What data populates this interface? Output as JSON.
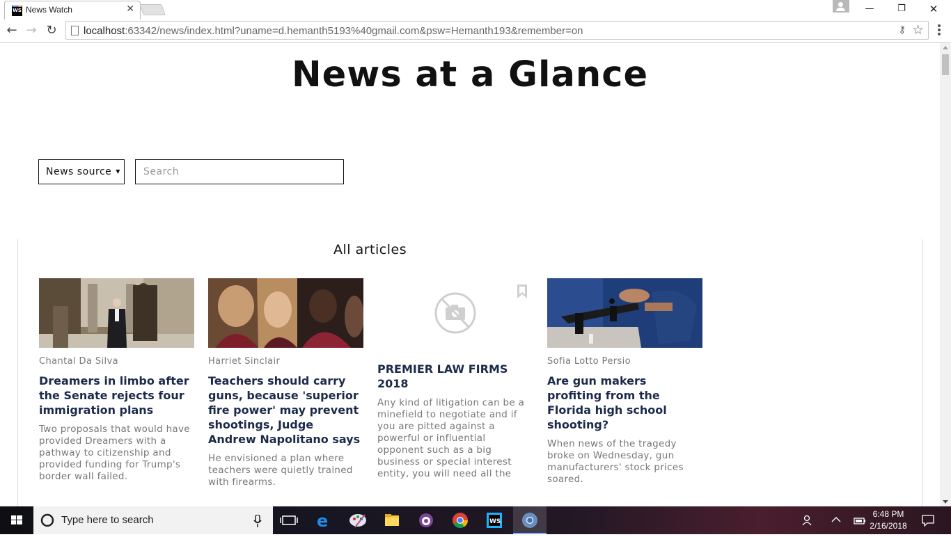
{
  "browser": {
    "tab_title": "News Watch",
    "tab_favicon_text": "WS",
    "url_host": "localhost",
    "url_rest": ":63342/news/index.html?uname=d.hemanth5193%40gmail.com&psw=Hemanth193&remember=on"
  },
  "page": {
    "title": "News at a Glance",
    "source_dropdown_label": "News source",
    "search_placeholder": "Search",
    "section_title": "All articles"
  },
  "articles": [
    {
      "author": "Chantal Da Silva",
      "headline": "Dreamers in limbo after the Senate rejects four immigration plans",
      "summary": "Two proposals that would have provided Dreamers with a pathway to citizenship and provided funding for Trump's border wall failed.",
      "image": "photo-senator-hallway"
    },
    {
      "author": "Harriet Sinclair",
      "headline": "Teachers should carry guns, because 'superior fire power' may prevent shootings, Judge Andrew Napolitano says",
      "summary": "He envisioned a plan where teachers were quietly trained with firearms.",
      "image": "photo-students-grieving"
    },
    {
      "author": "",
      "headline": "PREMIER LAW FIRMS 2018",
      "summary": "Any kind of litigation can be a minefield to negotiate and if you are pitted against a powerful or influential opponent such as a big business or special interest entity, you will need all the",
      "image": "no-image-icon"
    },
    {
      "author": "Sofia Lotto Persio",
      "headline": "Are gun makers profiting from the Florida high school shooting?",
      "summary": "When news of the tragedy broke on Wednesday, gun manufacturers' stock prices soared.",
      "image": "photo-gun-store"
    }
  ],
  "taskbar": {
    "search_placeholder": "Type here to search",
    "time": "6:48 PM",
    "date": "2/16/2018",
    "apps": [
      "task-view-icon",
      "edge-icon",
      "paint-icon",
      "file-explorer-icon",
      "tor-icon",
      "chrome-icon",
      "webstorm-icon",
      "chrome-canary-icon"
    ]
  },
  "colors": {
    "headline": "#1c2a4a",
    "muted_text": "#777777",
    "taskbar_active_underline": "#7fb4ff"
  }
}
